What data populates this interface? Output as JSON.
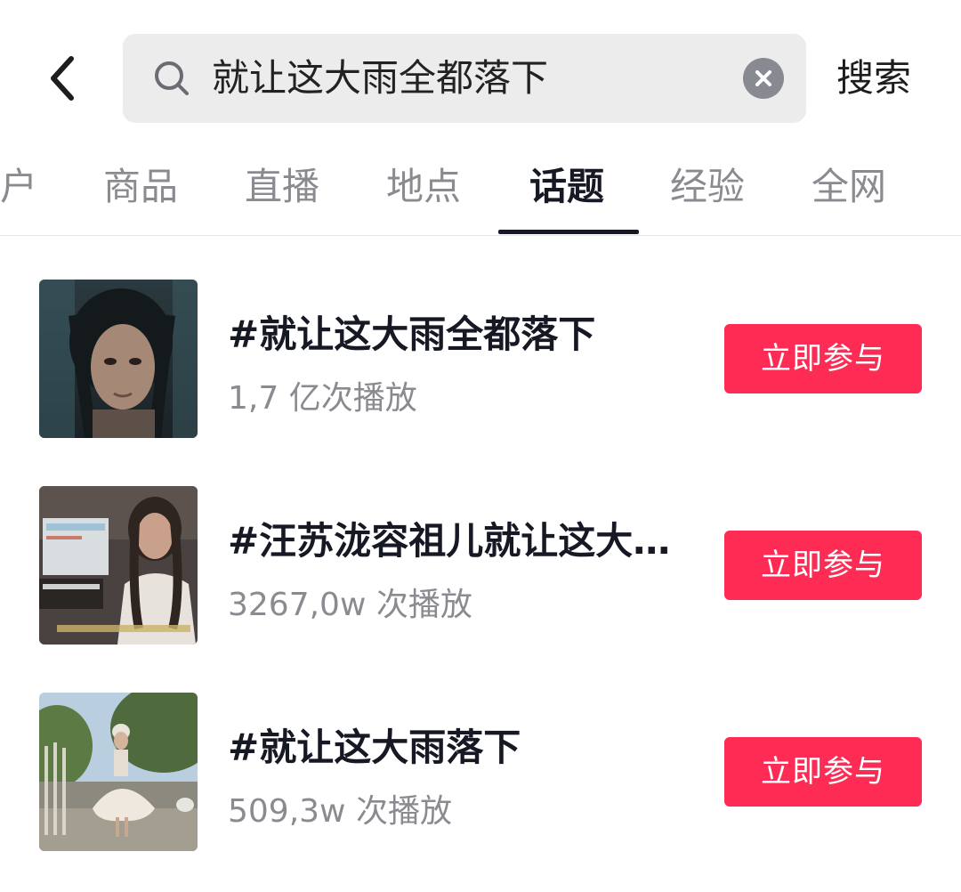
{
  "search": {
    "query": "就让这大雨全都落下",
    "submit_label": "搜索"
  },
  "tabs": [
    {
      "label": "户",
      "active": false
    },
    {
      "label": "商品",
      "active": false
    },
    {
      "label": "直播",
      "active": false
    },
    {
      "label": "地点",
      "active": false
    },
    {
      "label": "话题",
      "active": true
    },
    {
      "label": "经验",
      "active": false
    },
    {
      "label": "全网",
      "active": false
    }
  ],
  "topics": [
    {
      "title": "#就让这大雨全都落下",
      "plays": "1,7 亿次播放",
      "action_label": "立即参与"
    },
    {
      "title": "#汪苏泷容祖儿就让这大...",
      "plays": "3267,0w 次播放",
      "action_label": "立即参与"
    },
    {
      "title": "#就让这大雨落下",
      "plays": "509,3w 次播放",
      "action_label": "立即参与"
    }
  ],
  "colors": {
    "accent": "#fe2c55",
    "text_primary": "#161823",
    "text_secondary": "#8a8b90",
    "search_bg": "#ececec"
  },
  "icons": {
    "back": "chevron-left-icon",
    "search": "search-icon",
    "clear": "clear-icon"
  }
}
